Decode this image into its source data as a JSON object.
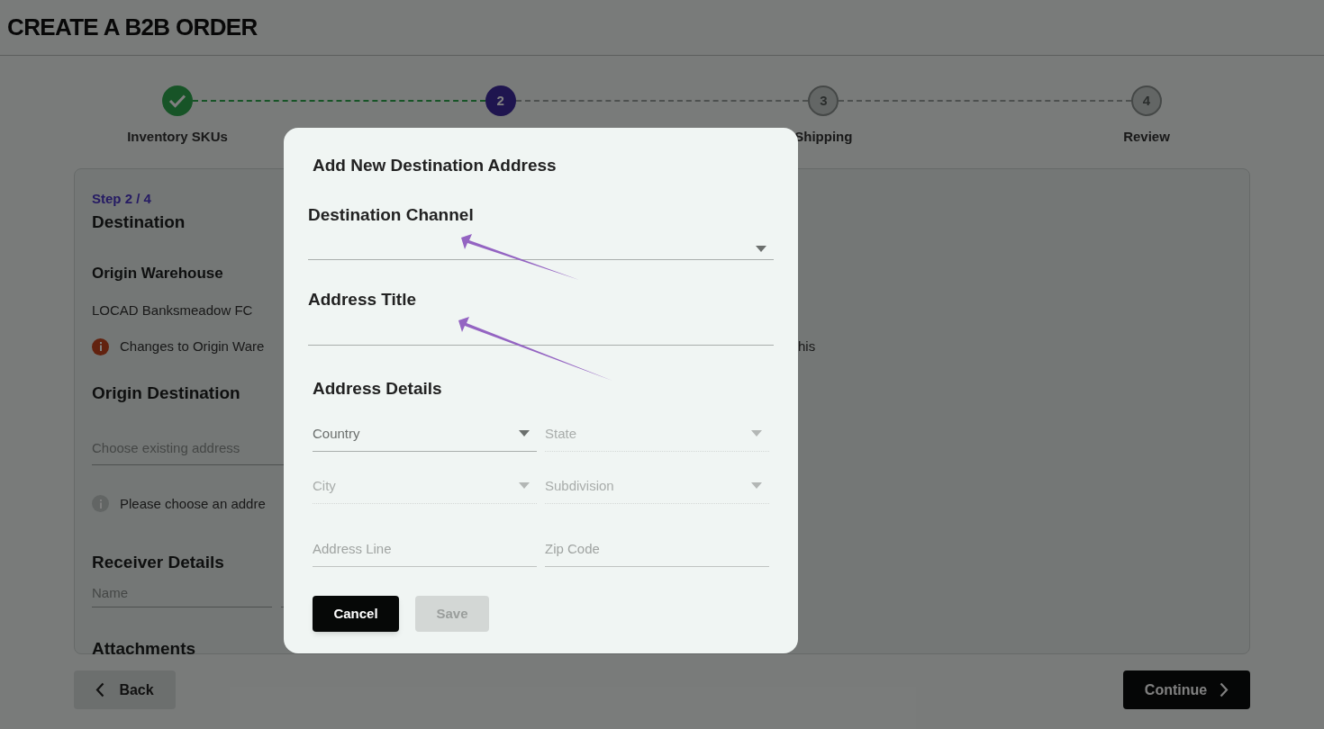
{
  "page": {
    "title": "CREATE A B2B ORDER"
  },
  "stepper": {
    "steps": [
      {
        "completed": true,
        "selected": false,
        "label": "Inventory SKUs"
      },
      {
        "completed": false,
        "selected": true,
        "number": "2"
      },
      {
        "completed": false,
        "selected": false,
        "number": "3",
        "label": "Shipping"
      },
      {
        "completed": false,
        "selected": false,
        "number": "4",
        "label": "Review"
      }
    ]
  },
  "card": {
    "step_caption": "Step 2 / 4",
    "heading": "Destination",
    "origin_warehouse": {
      "heading": "Origin Warehouse",
      "value": "LOCAD Banksmeadow FC",
      "note_start": "Changes to Origin Ware",
      "note_end": "his"
    },
    "origin_destination": {
      "heading": "Origin Destination",
      "placeholder": "Choose existing address",
      "hint": "Please choose an addre"
    },
    "receiver_details": {
      "heading": "Receiver Details",
      "name_placeholder": "Name"
    },
    "attachments": {
      "heading": "Attachments"
    }
  },
  "footer": {
    "back": "Back",
    "continue": "Continue"
  },
  "modal": {
    "title": "Add New Destination Address",
    "top_fields": [
      {
        "kind": "select",
        "label": "Destination Channel"
      },
      {
        "kind": "text",
        "label": "Address Title"
      }
    ],
    "details_heading": "Address Details",
    "fields": [
      {
        "kind": "select",
        "placeholder": "Country",
        "disabled": false
      },
      {
        "kind": "select",
        "placeholder": "State",
        "disabled": true
      },
      {
        "kind": "select",
        "placeholder": "City",
        "disabled": true
      },
      {
        "kind": "select",
        "placeholder": "Subdivision",
        "disabled": true
      },
      {
        "kind": "text",
        "placeholder": "Address Line",
        "disabled": false
      },
      {
        "kind": "text",
        "placeholder": "Zip Code",
        "disabled": false
      }
    ],
    "buttons": [
      {
        "label": "Cancel",
        "disabled": false
      },
      {
        "label": "Save",
        "disabled": true
      }
    ]
  }
}
